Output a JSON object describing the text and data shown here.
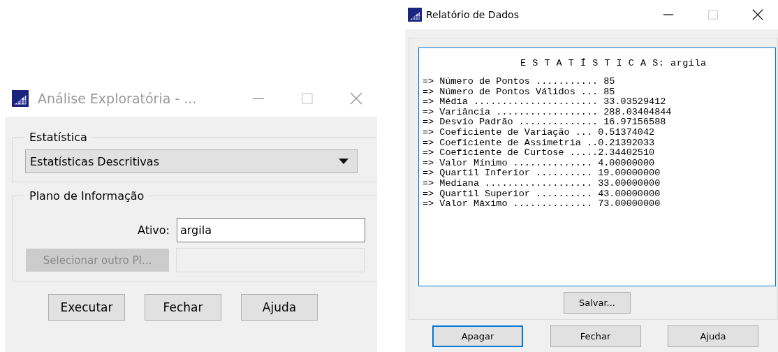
{
  "windows": [
    {
      "title": "Análise Exploratória - ...",
      "active": false,
      "groups": [
        {
          "kind": "select",
          "legend": "Estatística",
          "value": "Estatísticas Descritivas"
        },
        {
          "kind": "layer",
          "legend": "Plano de Informação",
          "label": "Ativo:",
          "value": "argila",
          "button": {
            "label": "Selecionar outro PI...",
            "disabled": true
          },
          "field_disabled": true
        }
      ],
      "buttons": [
        {
          "label": "Executar",
          "focused": false
        },
        {
          "label": "Fechar",
          "focused": false
        },
        {
          "label": "Ajuda",
          "focused": false
        }
      ]
    },
    {
      "title": "Relatório de Dados",
      "active": true,
      "report": {
        "heading": "E S T A T Í S T I C A S: argila",
        "lines": [
          "=> Número de Pontos ........... 85",
          "=> Número de Pontos Válidos ... 85",
          "=> Média ...................... 33.03529412",
          "=> Variância .................. 288.03404844",
          "=> Desvio Padrão .............. 16.97156588",
          "=> Coeficiente de Variação ... 0.51374042",
          "=> Coeficiente de Assimetria ..0.21392033",
          "=> Coeficiente de Curtose .....2.34402510",
          "=> Valor Mínimo .............. 4.00000000",
          "=> Quartil Inferior .......... 19.00000000",
          "=> Mediana ................... 33.00000000",
          "=> Quartil Superior .......... 43.00000000",
          "=> Valor Máximo .............. 73.00000000"
        ]
      },
      "save_button": "Salvar...",
      "buttons": [
        {
          "label": "Apagar",
          "focused": true
        },
        {
          "label": "Fechar",
          "focused": false
        },
        {
          "label": "Ajuda",
          "focused": false
        }
      ]
    }
  ]
}
